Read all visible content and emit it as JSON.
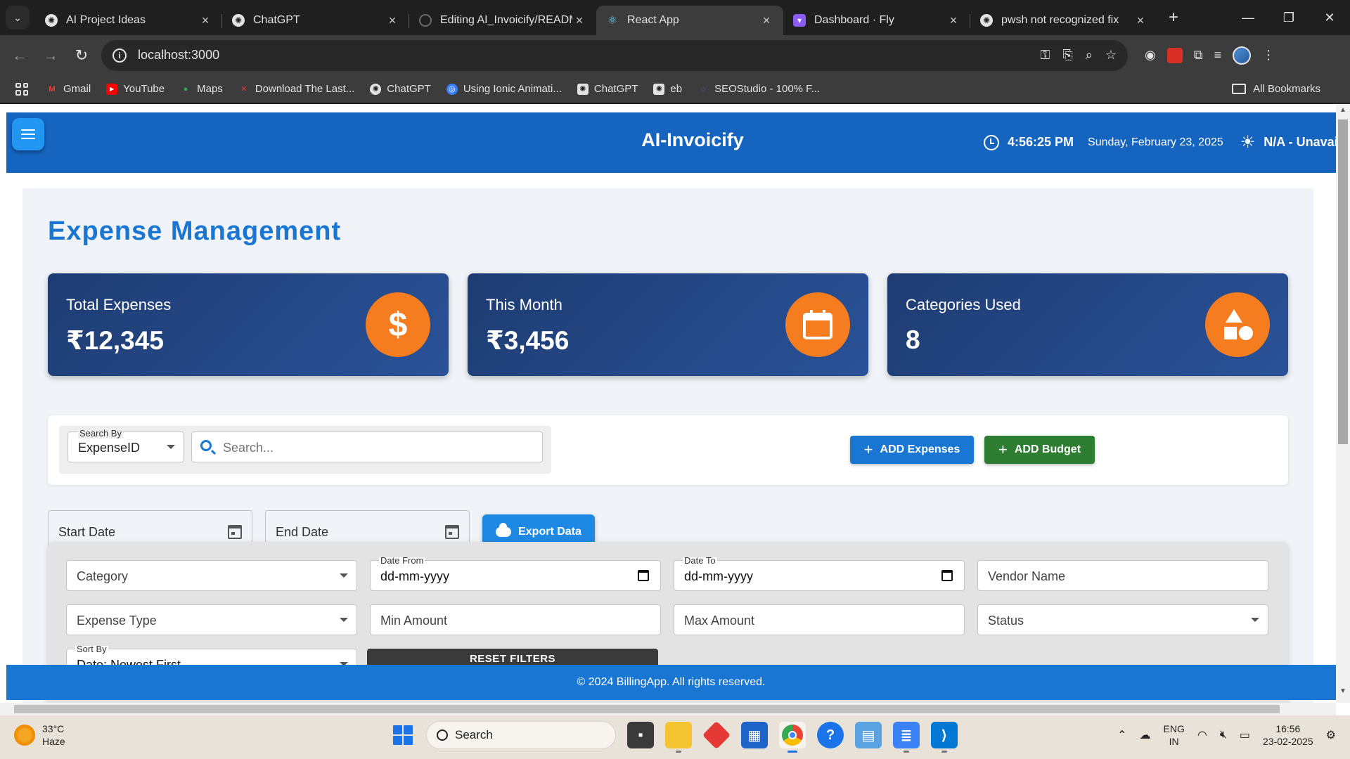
{
  "browser": {
    "tabs": [
      {
        "label": "AI Project Ideas",
        "active": false
      },
      {
        "label": "ChatGPT",
        "active": false
      },
      {
        "label": "Editing AI_Invoicify/READM",
        "active": false
      },
      {
        "label": "React App",
        "active": true
      },
      {
        "label": "Dashboard · Fly",
        "active": false
      },
      {
        "label": "pwsh not recognized fix",
        "active": false
      }
    ],
    "url": "localhost:3000",
    "bookmarks": [
      {
        "label": "Gmail",
        "icon": "gmail-icon"
      },
      {
        "label": "YouTube",
        "icon": "youtube-icon"
      },
      {
        "label": "Maps",
        "icon": "maps-icon"
      },
      {
        "label": "Download The Last...",
        "icon": "download-icon"
      },
      {
        "label": "ChatGPT",
        "icon": "chatgpt-icon"
      },
      {
        "label": "Using Ionic Animati...",
        "icon": "ionic-icon"
      },
      {
        "label": "ChatGPT",
        "icon": "chatgpt-icon"
      },
      {
        "label": "eb",
        "icon": "chatgpt-icon"
      },
      {
        "label": "SEOStudio - 100% F...",
        "icon": "seo-icon"
      }
    ],
    "all_bookmarks": "All Bookmarks"
  },
  "header": {
    "title": "AI-Invoicify",
    "time": "4:56:25 PM",
    "date": "Sunday, February 23, 2025",
    "weather": "N/A - Unavaila"
  },
  "page": {
    "title": "Expense Management",
    "stats": [
      {
        "label": "Total Expenses",
        "value": "₹12,345",
        "icon": "dollar-icon"
      },
      {
        "label": "This Month",
        "value": "₹3,456",
        "icon": "calendar-icon"
      },
      {
        "label": "Categories Used",
        "value": "8",
        "icon": "shapes-icon"
      }
    ],
    "search": {
      "search_by_label": "Search By",
      "search_by_value": "ExpenseID",
      "placeholder": "Search..."
    },
    "buttons": {
      "add_expenses": "ADD Expenses",
      "add_budget": "ADD Budget",
      "export": "Export Data",
      "reset": "RESET FILTERS"
    },
    "dates": {
      "start": "Start Date",
      "end": "End Date"
    },
    "filters": {
      "category": "Category",
      "date_from_label": "Date From",
      "date_from_value": "dd-mm-yyyy",
      "date_to_label": "Date To",
      "date_to_value": "dd-mm-yyyy",
      "vendor": "Vendor Name",
      "expense_type": "Expense Type",
      "min_amount": "Min Amount",
      "max_amount": "Max Amount",
      "status": "Status",
      "sort_by_label": "Sort By",
      "sort_by_value": "Date: Newest First"
    },
    "footer": "© 2024 BillingApp. All rights reserved."
  },
  "taskbar": {
    "temp": "33°C",
    "condition": "Haze",
    "search": "Search",
    "lang1": "ENG",
    "lang2": "IN",
    "time": "16:56",
    "date": "23-02-2025"
  },
  "colors": {
    "header_blue": "#1565c0",
    "title_blue": "#1976d2",
    "card_gradient_start": "#1e3c72",
    "card_gradient_end": "#2a5298",
    "icon_orange": "#f57c1f",
    "add_budget_green": "#2e7d32"
  }
}
